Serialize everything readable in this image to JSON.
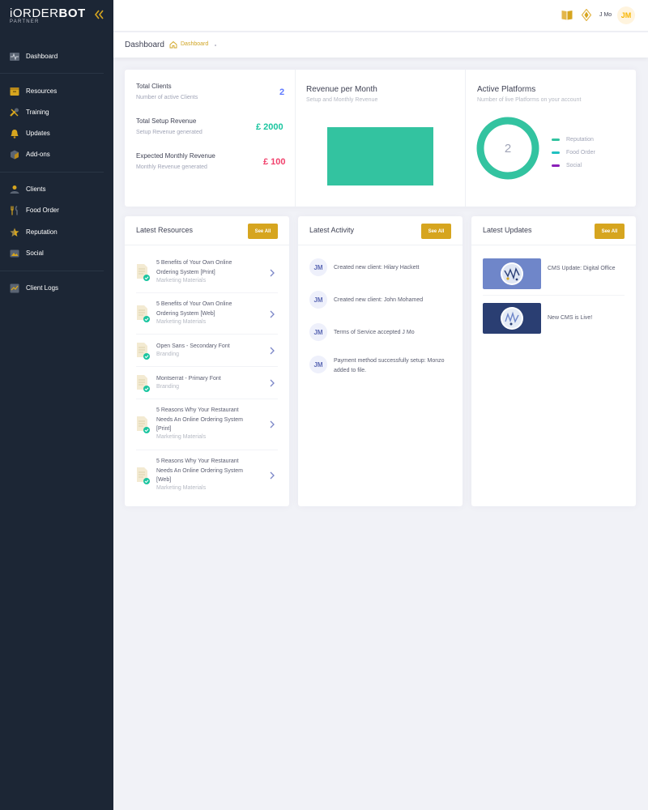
{
  "brand": {
    "name_light": "iORDER",
    "name_bold": "BOT",
    "sub": "PARTNER"
  },
  "sidebar": {
    "items": [
      {
        "label": "Dashboard",
        "icon": "activity-icon"
      },
      {
        "label": "Resources",
        "icon": "box-icon"
      },
      {
        "label": "Training",
        "icon": "tools-icon"
      },
      {
        "label": "Updates",
        "icon": "bell-icon"
      },
      {
        "label": "Add-ons",
        "icon": "cube-icon"
      },
      {
        "label": "Clients",
        "icon": "users-icon"
      },
      {
        "label": "Food Order",
        "icon": "fork-knife-icon"
      },
      {
        "label": "Reputation",
        "icon": "star-icon"
      },
      {
        "label": "Social",
        "icon": "social-icon"
      },
      {
        "label": "Client Logs",
        "icon": "log-icon"
      }
    ]
  },
  "topbar": {
    "user_name": "J Mo",
    "user_initials": "JM"
  },
  "subheader": {
    "title": "Dashboard",
    "crumb": "Dashboard"
  },
  "stats": [
    {
      "title": "Total Clients",
      "sub": "Number of active Clients",
      "value": "2",
      "color": "#5d78ff"
    },
    {
      "title": "Total Setup Revenue",
      "sub": "Setup Revenue generated",
      "value": "£ 2000",
      "color": "#1bc5a0"
    },
    {
      "title": "Expected Monthly Revenue",
      "sub": "Monthly Revenue generated",
      "value": "£ 100",
      "color": "#f1416c"
    }
  ],
  "revenue": {
    "title": "Revenue per Month",
    "sub": "Setup and Monthly Revenue",
    "bar_color": "#33c3a0"
  },
  "platforms": {
    "title": "Active Platforms",
    "sub": "Number of live Platforms on your account",
    "center_value": "2",
    "legend": [
      {
        "label": "Reputation",
        "color": "#33c3a0"
      },
      {
        "label": "Food Order",
        "color": "#1fc0c0"
      },
      {
        "label": "Social",
        "color": "#8a1fb8"
      }
    ]
  },
  "chart_data": {
    "type": "pie",
    "title": "Active Platforms",
    "categories": [
      "Reputation",
      "Food Order",
      "Social"
    ],
    "values": [
      2,
      0,
      0
    ],
    "center_label": "2"
  },
  "resources": {
    "title": "Latest Resources",
    "see_all": "See All",
    "items": [
      {
        "title": "5 Benefits of Your Own Online Ordering System [Print]",
        "cat": "Marketing Materials"
      },
      {
        "title": "5 Benefits of Your Own Online Ordering System [Web]",
        "cat": "Marketing Materials"
      },
      {
        "title": "Open Sans - Secondary Font",
        "cat": "Branding"
      },
      {
        "title": "Montserrat - Primary Font",
        "cat": "Branding"
      },
      {
        "title": "5 Reasons Why Your Restaurant Needs An Online Ordering System [Print]",
        "cat": "Marketing Materials"
      },
      {
        "title": "5 Reasons Why Your Restaurant Needs An Online Ordering System [Web]",
        "cat": "Marketing Materials"
      }
    ]
  },
  "activity": {
    "title": "Latest Activity",
    "see_all": "See All",
    "items": [
      {
        "initials": "JM",
        "text": "Created new client: Hilary Hackett"
      },
      {
        "initials": "JM",
        "text": "Created new client: John Mohamed"
      },
      {
        "initials": "JM",
        "text": "Terms of Service accepted J Mo"
      },
      {
        "initials": "JM",
        "text": "Payment method successfully setup: Monzo added to file."
      }
    ]
  },
  "updates": {
    "title": "Latest Updates",
    "see_all": "See All",
    "items": [
      {
        "text": "CMS Update: Digital Office"
      },
      {
        "text": "New CMS is Live!"
      }
    ]
  }
}
